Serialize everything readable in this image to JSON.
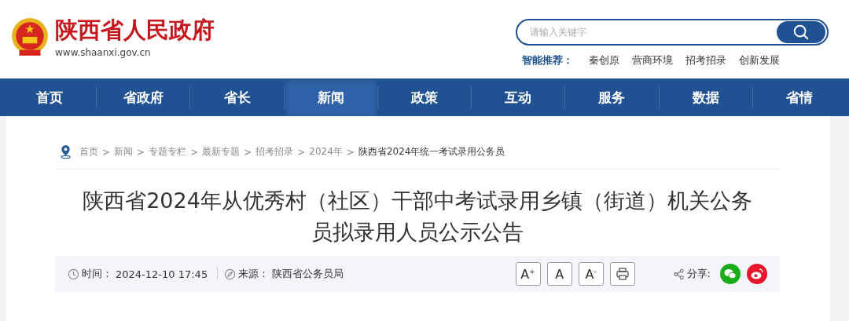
{
  "header": {
    "site_name": "陕西省人民政府",
    "site_url": "www.shaanxi.gov.cn",
    "search": {
      "placeholder": "请输入关键字"
    },
    "recommend_label": "智能推荐：",
    "recommend_links": [
      "秦创原",
      "营商环境",
      "招考招录",
      "创新发展"
    ]
  },
  "nav": [
    {
      "label": "首页",
      "selected": false
    },
    {
      "label": "省政府",
      "selected": false
    },
    {
      "label": "省长",
      "selected": false
    },
    {
      "label": "新闻",
      "selected": true
    },
    {
      "label": "政策",
      "selected": false
    },
    {
      "label": "互动",
      "selected": false
    },
    {
      "label": "服务",
      "selected": false
    },
    {
      "label": "数据",
      "selected": false
    },
    {
      "label": "省情",
      "selected": false
    }
  ],
  "breadcrumb_separator": ">",
  "breadcrumb": [
    {
      "label": "首页",
      "current": false
    },
    {
      "label": "新闻",
      "current": false
    },
    {
      "label": "专题专栏",
      "current": false
    },
    {
      "label": "最新专题",
      "current": false
    },
    {
      "label": "招考招录",
      "current": false
    },
    {
      "label": "2024年",
      "current": false
    },
    {
      "label": "陕西省2024年统一考试录用公务员",
      "current": true
    }
  ],
  "article": {
    "title": "陕西省2024年从优秀村（社区）干部中考试录用乡镇（街道）机关公务员拟录用人员公示公告",
    "time_label": "时间：",
    "time": "2024-12-10 17:45",
    "source_label": "来源：",
    "source": "陕西省公务员局",
    "font_buttons": [
      "A$^{+}$",
      "A",
      "A$^{-}$"
    ],
    "share_label": "分享:",
    "share": [
      {
        "kind": "wechat"
      },
      {
        "kind": "weibo"
      }
    ]
  }
}
